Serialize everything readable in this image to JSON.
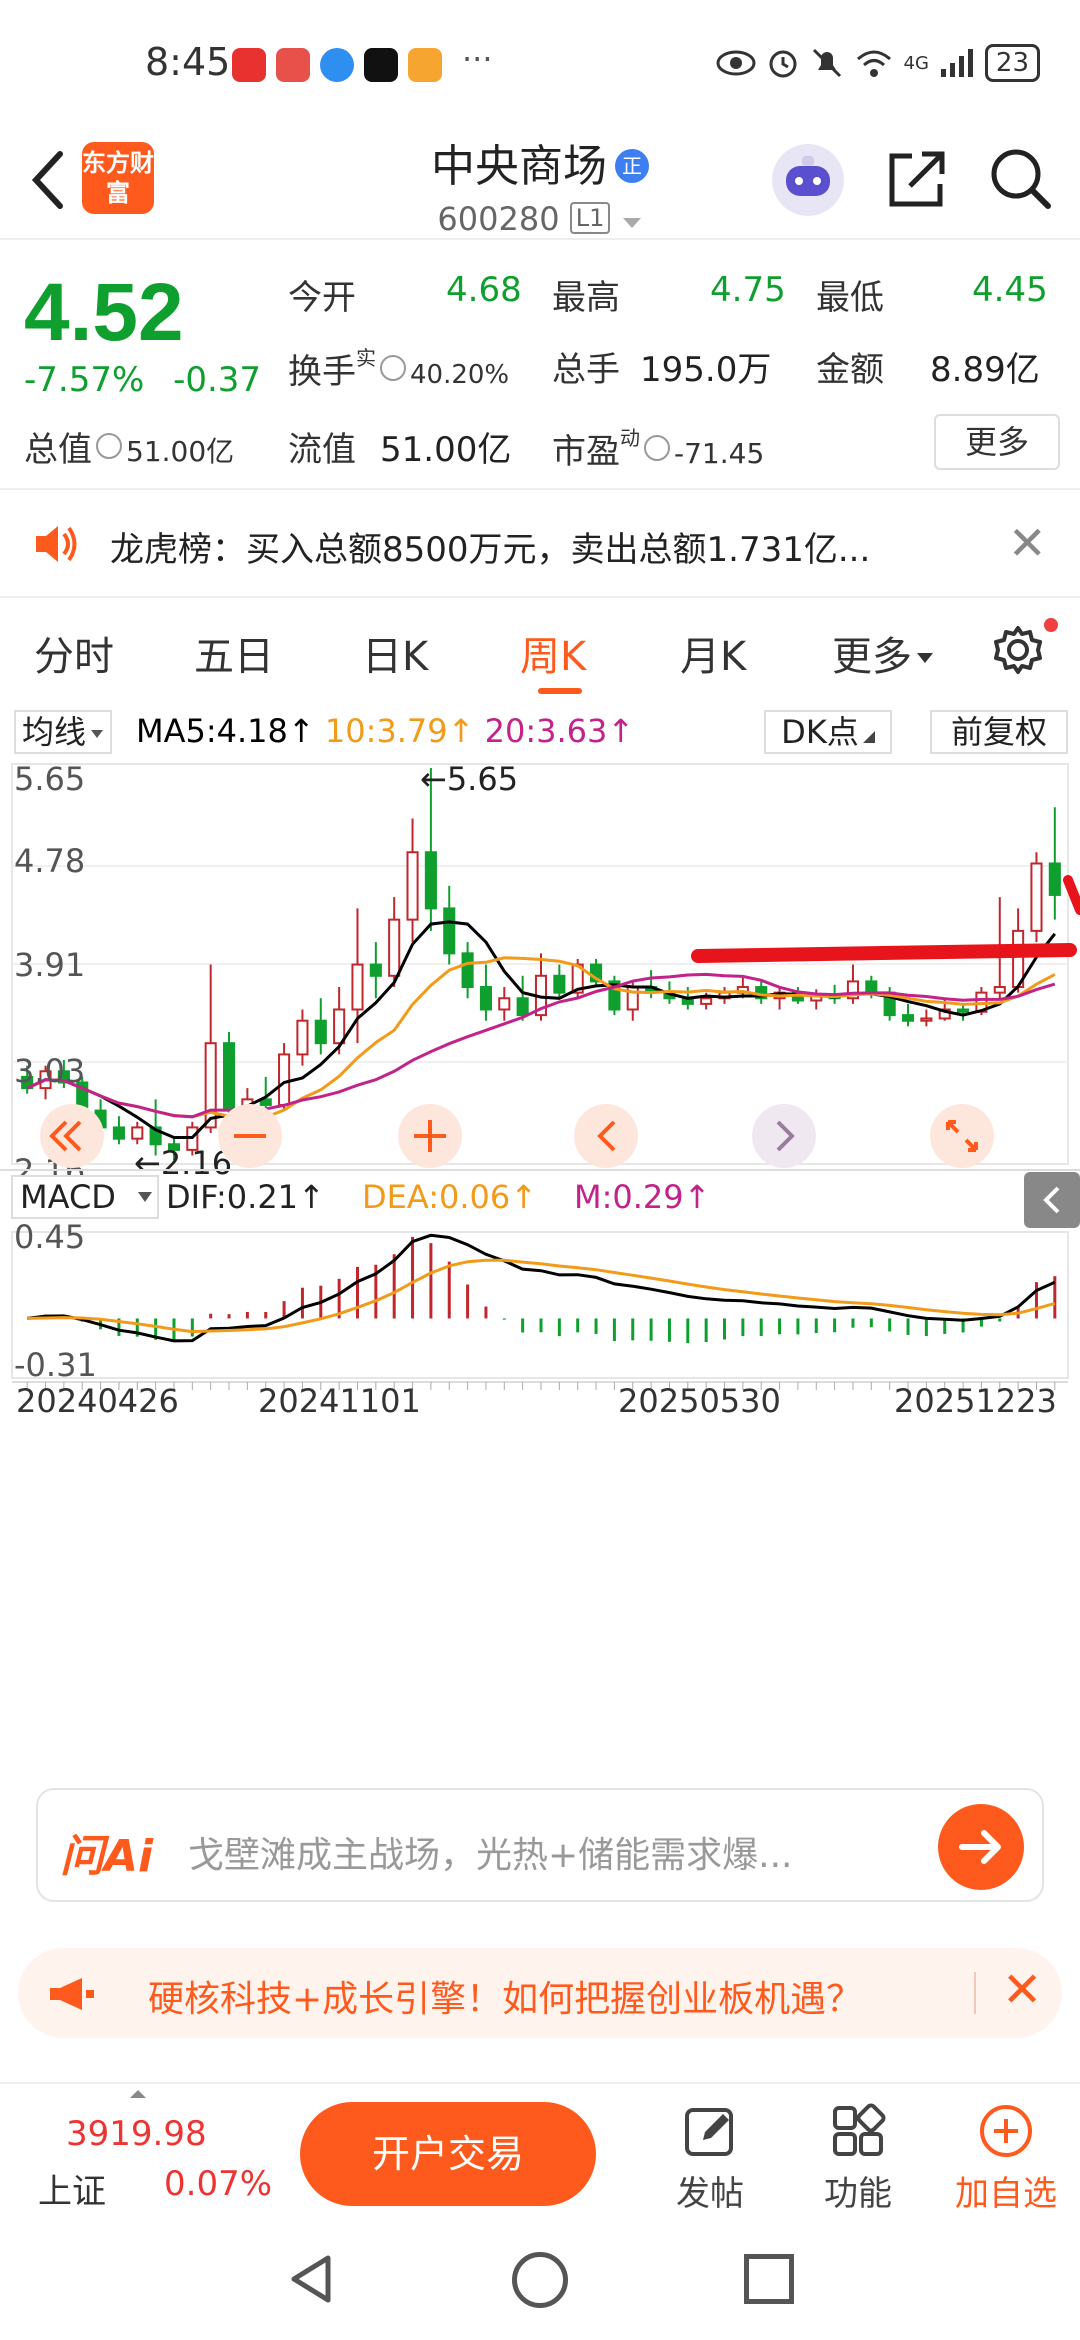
{
  "status_bar": {
    "time": "8:45",
    "dots": "···",
    "battery": "23",
    "network": "4G"
  },
  "header": {
    "logo_text": "东方财富",
    "stock_name": "中央商场",
    "badge": "正",
    "stock_code": "600280",
    "level_tag": "L1"
  },
  "quote": {
    "price": "4.52",
    "change_pct": "-7.57%",
    "change_amt": "-0.37",
    "open_label": "今开",
    "open_value": "4.68",
    "high_label": "最高",
    "high_value": "4.75",
    "low_label": "最低",
    "low_value": "4.45",
    "turnover_label": "换手",
    "turnover_sup": "实",
    "turnover_value": "40.20%",
    "volume_label": "总手",
    "volume_value": "195.0万",
    "amount_label": "金额",
    "amount_value": "8.89亿",
    "mktcap_label": "总值",
    "mktcap_value": "51.00亿",
    "float_label": "流值",
    "float_value": "51.00亿",
    "pe_label": "市盈",
    "pe_sup": "动",
    "pe_value": "-71.45",
    "more_label": "更多"
  },
  "notice": {
    "text": "龙虎榜：买入总额8500万元，卖出总额1.731亿..."
  },
  "tabs": [
    {
      "label": "分时"
    },
    {
      "label": "五日"
    },
    {
      "label": "日K"
    },
    {
      "label": "周K"
    },
    {
      "label": "月K"
    },
    {
      "label": "更多"
    }
  ],
  "ma_bar": {
    "select_label": "均线",
    "ma5": "MA5:4.18",
    "ma10": "10:3.79",
    "ma20": "20:3.63",
    "dk_label": "DK点",
    "adjust_label": "前复权"
  },
  "chart_data": {
    "type": "candlestick",
    "period": "weekly",
    "y_ticks": [
      "5.65",
      "4.78",
      "3.91",
      "3.03",
      "2.16"
    ],
    "ylim": [
      2.16,
      5.65
    ],
    "max_label": "5.65",
    "min_label": "2.16",
    "x_ticks": [
      "20240426",
      "20241101",
      "20250530",
      "20251223"
    ],
    "candles": [
      [
        2.9,
        3.0,
        2.75,
        2.8
      ],
      [
        2.8,
        3.0,
        2.7,
        2.95
      ],
      [
        2.95,
        3.05,
        2.8,
        2.85
      ],
      [
        2.85,
        2.9,
        2.55,
        2.6
      ],
      [
        2.6,
        2.7,
        2.4,
        2.45
      ],
      [
        2.45,
        2.55,
        2.3,
        2.35
      ],
      [
        2.35,
        2.5,
        2.3,
        2.45
      ],
      [
        2.45,
        2.7,
        2.2,
        2.3
      ],
      [
        2.3,
        2.35,
        2.16,
        2.25
      ],
      [
        2.25,
        2.5,
        2.2,
        2.45
      ],
      [
        2.45,
        3.9,
        2.4,
        3.2
      ],
      [
        3.2,
        3.3,
        2.5,
        2.6
      ],
      [
        2.6,
        2.8,
        2.5,
        2.7
      ],
      [
        2.7,
        2.9,
        2.6,
        2.65
      ],
      [
        2.65,
        3.2,
        2.6,
        3.1
      ],
      [
        3.1,
        3.5,
        3.0,
        3.4
      ],
      [
        3.4,
        3.6,
        3.1,
        3.2
      ],
      [
        3.2,
        3.7,
        3.1,
        3.5
      ],
      [
        3.5,
        4.4,
        3.2,
        3.9
      ],
      [
        3.9,
        4.1,
        3.6,
        3.8
      ],
      [
        3.8,
        4.5,
        3.7,
        4.3
      ],
      [
        4.3,
        5.2,
        4.1,
        4.9
      ],
      [
        4.9,
        5.65,
        4.2,
        4.4
      ],
      [
        4.4,
        4.6,
        3.9,
        4.0
      ],
      [
        4.0,
        4.1,
        3.6,
        3.7
      ],
      [
        3.7,
        3.9,
        3.4,
        3.5
      ],
      [
        3.5,
        3.7,
        3.4,
        3.6
      ],
      [
        3.6,
        3.8,
        3.4,
        3.45
      ],
      [
        3.45,
        4.0,
        3.4,
        3.8
      ],
      [
        3.8,
        3.9,
        3.6,
        3.65
      ],
      [
        3.65,
        3.95,
        3.6,
        3.9
      ],
      [
        3.9,
        3.95,
        3.7,
        3.75
      ],
      [
        3.75,
        3.8,
        3.45,
        3.5
      ],
      [
        3.5,
        3.75,
        3.4,
        3.7
      ],
      [
        3.7,
        3.85,
        3.6,
        3.65
      ],
      [
        3.65,
        3.75,
        3.55,
        3.6
      ],
      [
        3.6,
        3.7,
        3.5,
        3.55
      ],
      [
        3.55,
        3.65,
        3.5,
        3.6
      ],
      [
        3.6,
        3.7,
        3.55,
        3.65
      ],
      [
        3.65,
        3.8,
        3.6,
        3.7
      ],
      [
        3.7,
        3.75,
        3.55,
        3.6
      ],
      [
        3.6,
        3.7,
        3.5,
        3.65
      ],
      [
        3.65,
        3.7,
        3.55,
        3.58
      ],
      [
        3.58,
        3.68,
        3.5,
        3.62
      ],
      [
        3.62,
        3.72,
        3.55,
        3.6
      ],
      [
        3.6,
        3.9,
        3.55,
        3.75
      ],
      [
        3.75,
        3.8,
        3.6,
        3.65
      ],
      [
        3.65,
        3.7,
        3.4,
        3.45
      ],
      [
        3.45,
        3.55,
        3.35,
        3.4
      ],
      [
        3.4,
        3.5,
        3.35,
        3.42
      ],
      [
        3.42,
        3.6,
        3.4,
        3.5
      ],
      [
        3.5,
        3.55,
        3.4,
        3.48
      ],
      [
        3.48,
        3.7,
        3.45,
        3.65
      ],
      [
        3.65,
        4.5,
        3.6,
        3.7
      ],
      [
        3.7,
        4.4,
        3.65,
        4.2
      ],
      [
        4.2,
        4.9,
        4.1,
        4.8
      ],
      [
        4.8,
        5.3,
        4.3,
        4.52
      ]
    ],
    "macd": {
      "label": "MACD",
      "dif": "DIF:0.21",
      "dea": "DEA:0.06",
      "m": "M:0.29",
      "y_ticks": [
        "0.45",
        "-0.31"
      ],
      "ylim": [
        -0.31,
        0.45
      ]
    }
  },
  "ai": {
    "logo": "问Ai",
    "placeholder": "戈壁滩成主战场，光热+储能需求爆..."
  },
  "banner": {
    "text": "硬核科技+成长引擎！如何把握创业板机遇？"
  },
  "bottom_bar": {
    "index_value": "3919.98",
    "index_name": "上证",
    "index_pct": "0.07%",
    "trade_label": "开户交易",
    "post_label": "发帖",
    "func_label": "功能",
    "watch_label": "加自选"
  },
  "colors": {
    "accent": "#ff5a1e",
    "down": "#0e9f2f",
    "up": "#c0272d",
    "ma5": "#000000",
    "ma10": "#f29a1a",
    "ma20": "#c2238a"
  }
}
